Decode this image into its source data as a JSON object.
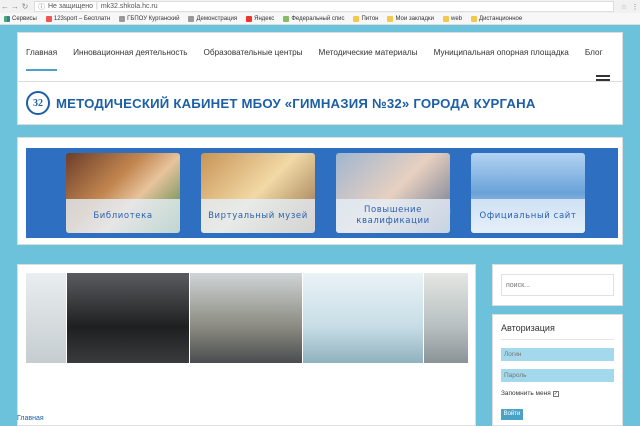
{
  "browser": {
    "insecure_label": "Не защищено",
    "url": "mk32.shkola.hc.ru",
    "bookmarks": [
      {
        "label": "Сервисы",
        "icon": "apps-icon"
      },
      {
        "label": "123sport – Бесплатн",
        "icon": "mail-icon"
      },
      {
        "label": "ГБПОУ Курганский",
        "icon": "page-icon"
      },
      {
        "label": "Демонстрация",
        "icon": "page-icon"
      },
      {
        "label": "Яндекс",
        "icon": "yandex-icon"
      },
      {
        "label": "Федеральный спис",
        "icon": "federal-icon"
      },
      {
        "label": "Питон",
        "icon": "folder-icon"
      },
      {
        "label": "Мои закладки",
        "icon": "folder-icon"
      },
      {
        "label": "web",
        "icon": "folder-icon"
      },
      {
        "label": "Дистанционное",
        "icon": "folder-icon"
      }
    ]
  },
  "nav": {
    "items": [
      "Главная",
      "Инновационная деятельность",
      "Образовательные центры",
      "Методические материалы",
      "Муниципальная опорная площадка",
      "Блог"
    ]
  },
  "site": {
    "logo_text": "32",
    "title": "МЕТОДИЧЕСКИЙ КАБИНЕТ МБОУ «ГИМНАЗИЯ №32» ГОРОДА КУРГАНА"
  },
  "banner": {
    "tiles": [
      "Библиотека",
      "Виртуальный музей",
      "Повышение квалификации",
      "Официальный сайт"
    ]
  },
  "breadcrumb": "Главная",
  "sidebar": {
    "search_placeholder": "поиск...",
    "auth": {
      "title": "Авторизация",
      "login_placeholder": "Логин",
      "password_placeholder": "Пароль",
      "remember_label": "Запомнить меня",
      "submit_label": "Войти"
    }
  },
  "colors": {
    "page_bg": "#6cc2da",
    "accent": "#4aa3c7",
    "brand": "#1c5fa5",
    "banner_bg": "#2f6fc1"
  }
}
